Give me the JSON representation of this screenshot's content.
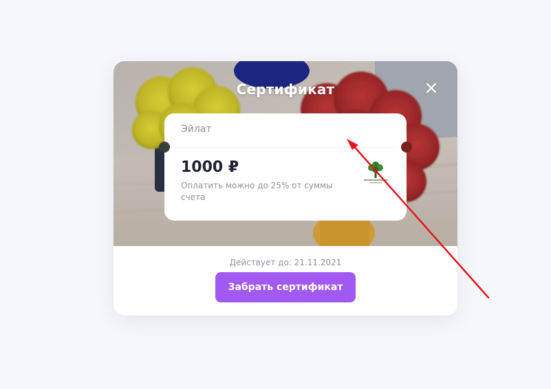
{
  "modal": {
    "title": "Сертификат",
    "close_icon": "close-icon"
  },
  "certificate": {
    "store_name": "Эйлат",
    "amount": "1000 ₽",
    "note": "Оплатить можно до 25% от суммы счета",
    "logo_icon": "tree-logo-icon"
  },
  "footer": {
    "valid_until": "Действует до: 21.11.2021",
    "claim_button_label": "Забрать сертификат"
  },
  "colors": {
    "page_background": "#f6f7fc",
    "accent": "#a259f2",
    "annotation_arrow": "#e8141c",
    "muted_text": "#8e919e",
    "primary_text": "#1f2230"
  }
}
